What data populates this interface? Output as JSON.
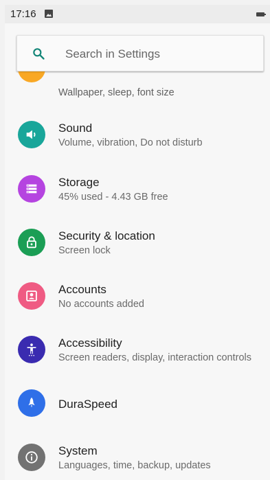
{
  "status_bar": {
    "time": "17:16"
  },
  "search": {
    "placeholder": "Search in Settings"
  },
  "items": [
    {
      "title": "",
      "subtitle": "Wallpaper, sleep, font size",
      "color": "#f9a825",
      "icon": "display-icon"
    },
    {
      "title": "Sound",
      "subtitle": "Volume, vibration, Do not disturb",
      "color": "#19a69a",
      "icon": "volume-icon"
    },
    {
      "title": "Storage",
      "subtitle": "45% used - 4.43 GB free",
      "color": "#b544e0",
      "icon": "storage-icon"
    },
    {
      "title": "Security & location",
      "subtitle": "Screen lock",
      "color": "#1b9e55",
      "icon": "lock-icon"
    },
    {
      "title": "Accounts",
      "subtitle": "No accounts added",
      "color": "#ef5b83",
      "icon": "account-icon"
    },
    {
      "title": "Accessibility",
      "subtitle": "Screen readers, display, interaction controls",
      "color": "#3a2bb0",
      "icon": "accessibility-icon"
    },
    {
      "title": "DuraSpeed",
      "subtitle": "",
      "color": "#2f6fe8",
      "icon": "rocket-icon"
    },
    {
      "title": "System",
      "subtitle": "Languages, time, backup, updates",
      "color": "#727272",
      "icon": "info-icon"
    }
  ]
}
